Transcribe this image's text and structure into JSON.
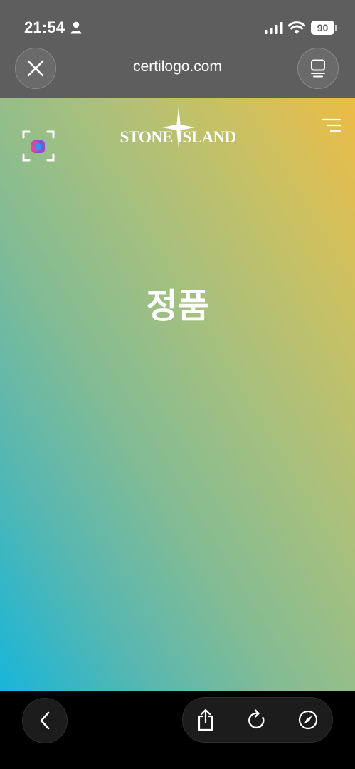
{
  "status_bar": {
    "time": "21:54",
    "battery": "90",
    "icons": [
      "person-icon",
      "signal-icon",
      "wifi-icon",
      "battery-icon"
    ]
  },
  "browser": {
    "url": "certilogo.com",
    "close_icon": "close-icon",
    "tabs_icon": "tabs-icon"
  },
  "page": {
    "brand_logo": "STONE ISLAND",
    "status_heading": "정품",
    "icons": [
      "scan-icon",
      "compass-rose-logo-icon",
      "menu-icon"
    ],
    "background_gradient": [
      "#ecbc46",
      "#a6c07e",
      "#17b6d9"
    ]
  },
  "toolbar": {
    "icons": [
      "back-chevron-icon",
      "share-icon",
      "reload-icon",
      "compass-icon"
    ]
  },
  "colors": {
    "chrome": "#5e5e5e",
    "toolbar": "#000000",
    "text": "#ffffff"
  }
}
